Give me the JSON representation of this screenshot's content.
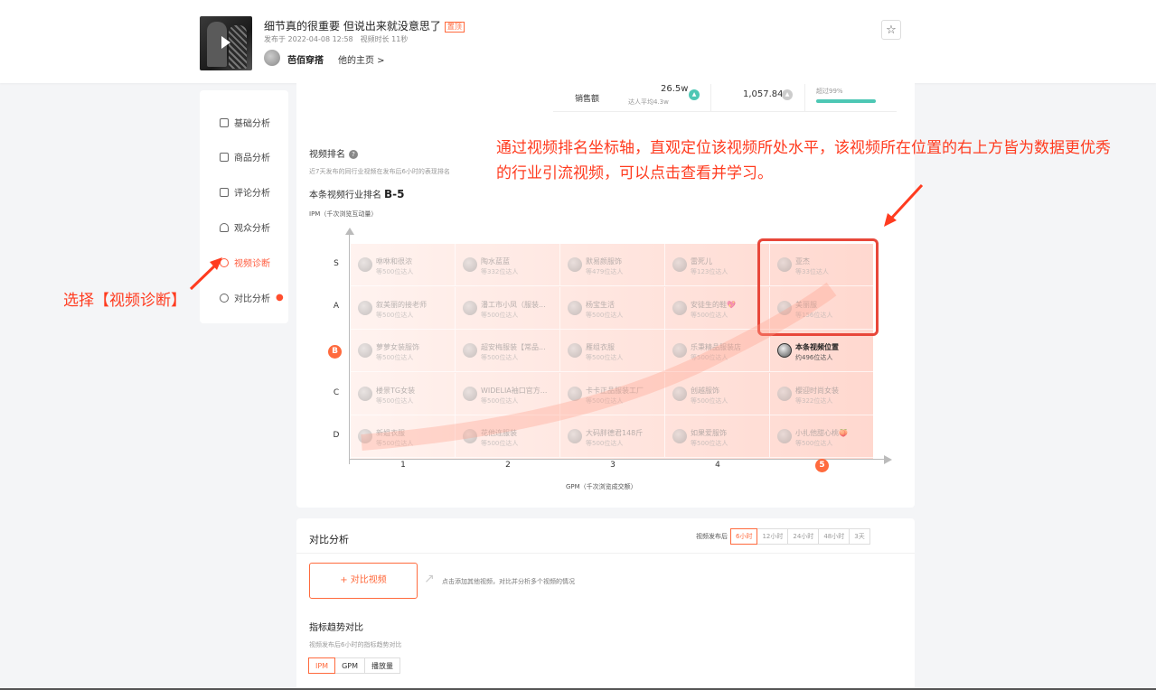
{
  "header": {
    "title": "细节真的很重要 但说出来就没意思了",
    "title_tag": "置顶",
    "publish_time": "发布于 2022-04-08 12:58",
    "duration": "视频时长 11秒",
    "author": "芭佰穿搭",
    "home_link": "他的主页 >"
  },
  "sidebar": {
    "items": [
      {
        "label": "基础分析",
        "icon": "chart-icon"
      },
      {
        "label": "商品分析",
        "icon": "bag-icon"
      },
      {
        "label": "评论分析",
        "icon": "comment-icon"
      },
      {
        "label": "观众分析",
        "icon": "user-icon"
      },
      {
        "label": "视频诊断",
        "icon": "diagnose-icon"
      },
      {
        "label": "对比分析",
        "icon": "compare-icon"
      }
    ]
  },
  "sales": {
    "label": "销售额",
    "value": "26.5w",
    "avg": "达人平均4.3w",
    "value2": "1,057.84",
    "exceed": "超过99%"
  },
  "ranking": {
    "title": "视频排名",
    "subtitle": "近7天发布的同行业视频在发布后6小时的表现排名",
    "current_label": "本条视频行业排名",
    "current_rank": "B-5",
    "y_axis_label": "IPM（千次浏览互动量）",
    "x_axis_label": "GPM（千次浏览成交额）",
    "rows": [
      "S",
      "A",
      "B",
      "C",
      "D"
    ],
    "cols": [
      "1",
      "2",
      "3",
      "4",
      "5"
    ],
    "highlight_row": "B",
    "highlight_col": "5",
    "cells": [
      [
        {
          "name": "咻咻和很浓",
          "count": "等500位达人"
        },
        {
          "name": "陶水蓝蓝",
          "count": "等332位达人"
        },
        {
          "name": "默易颜服饰",
          "count": "等479位达人"
        },
        {
          "name": "雷死儿",
          "count": "等123位达人"
        },
        {
          "name": "亚杰",
          "count": "等33位达人"
        }
      ],
      [
        {
          "name": "叙美丽的接老师",
          "count": "等500位达人"
        },
        {
          "name": "潘工市小凤（服装...",
          "count": "等500位达人"
        },
        {
          "name": "杨宝生活",
          "count": "等500位达人"
        },
        {
          "name": "安徒生的鞋💖",
          "count": "等500位达人"
        },
        {
          "name": "美丽服",
          "count": "等156位达人"
        }
      ],
      [
        {
          "name": "萝萝女装服饰",
          "count": "等500位达人"
        },
        {
          "name": "超安梅服装【常品...",
          "count": "等500位达人"
        },
        {
          "name": "雁组衣服",
          "count": "等500位达人"
        },
        {
          "name": "乐秉精品服装店",
          "count": "等500位达人"
        },
        {
          "name": "本条视频位置",
          "count": "约496位达人"
        }
      ],
      [
        {
          "name": "楼景TG女装",
          "count": "等500位达人"
        },
        {
          "name": "WIDELIA袖口官方...",
          "count": "等500位达人"
        },
        {
          "name": "卡卡正品服装工厂",
          "count": "等500位达人"
        },
        {
          "name": "创越服饰",
          "count": "等500位达人"
        },
        {
          "name": "樱迎时尚女装",
          "count": "等322位达人"
        }
      ],
      [
        {
          "name": "新姐衣服",
          "count": "等500位达人"
        },
        {
          "name": "花他连服装",
          "count": "等500位达人"
        },
        {
          "name": "大码胖德君148斤",
          "count": "等500位达人"
        },
        {
          "name": "如果爱服饰",
          "count": "等500位达人"
        },
        {
          "name": "小扎他甜心桃🍑",
          "count": "等500位达人"
        }
      ]
    ]
  },
  "annotations": {
    "top": "通过视频排名坐标轴，直观定位该视频所处水平，该视频所在位置的右上方皆为数据更优秀的行业引流视频，可以点击查看并学习。",
    "left": "选择【视频诊断】"
  },
  "compare": {
    "title": "对比分析",
    "time_label": "视频发布后",
    "time_tabs": [
      "6小时",
      "12小时",
      "24小时",
      "48小时",
      "3天"
    ],
    "add_button": "+ 对比视频",
    "add_hint": "点击添加其他视频，对比并分析多个视频的情况",
    "trend_title": "指标趋势对比",
    "trend_sub": "视频发布后6小时的指标趋势对比",
    "metric_tabs": [
      "IPM",
      "GPM",
      "播放量"
    ]
  },
  "colors": {
    "accent": "#ff6a3d",
    "annotation": "#ff3b1f",
    "teal": "#4dc7b4"
  }
}
